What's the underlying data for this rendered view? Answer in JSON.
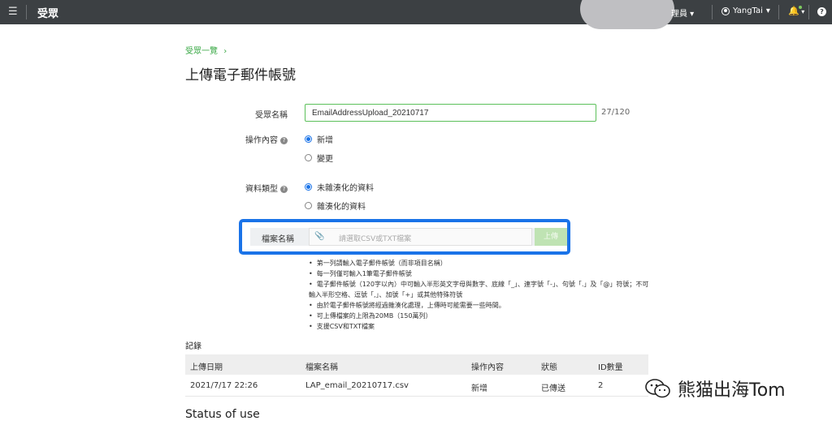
{
  "header": {
    "menu_icon": "hamburger-icon",
    "app_title": "受眾",
    "role_menu": "理員",
    "user_name": "YangTai",
    "bell_icon": "bell-icon",
    "help_icon": "help-icon"
  },
  "breadcrumb": {
    "link": "受眾一覽",
    "separator": "›"
  },
  "page_title": "上傳電子郵件帳號",
  "form": {
    "audience_name": {
      "label": "受眾名稱",
      "value": "EmailAddressUpload_20210717",
      "counter": "27/120"
    },
    "operation": {
      "label": "操作內容",
      "options": [
        {
          "label": "新增",
          "selected": true
        },
        {
          "label": "變更",
          "selected": false
        }
      ]
    },
    "data_type": {
      "label": "資料類型",
      "options": [
        {
          "label": "未雜湊化的資料",
          "selected": true
        },
        {
          "label": "雜湊化的資料",
          "selected": false
        }
      ]
    },
    "file": {
      "label": "檔案名稱",
      "placeholder": "請選取CSV或TXT檔案",
      "upload_label": "上傳"
    }
  },
  "notes": [
    "第一列請輸入電子郵件帳號（而非項目名稱）",
    "每一列僅可輸入1筆電子郵件帳號",
    "電子郵件帳號（120字以內）中可輸入半形英文字母與數字、底線「_」、連字號「-」、句號「.」及「@」符號；不可輸入半形空格、逗號「,」、加號「+」或其他特殊符號",
    "由於電子郵件帳號將經過雜湊化處理，上傳時可能需要一些時間。",
    "可上傳檔案的上限為20MB（150萬列）",
    "支援CSV和TXT檔案"
  ],
  "records": {
    "title": "記錄",
    "columns": [
      "上傳日期",
      "檔案名稱",
      "操作內容",
      "狀態",
      "ID數量"
    ],
    "rows": [
      [
        "2021/7/17 22:26",
        "LAP_email_20210717.csv",
        "新增",
        "已傳送",
        "2"
      ]
    ]
  },
  "watermark": "熊猫出海Tom",
  "status_heading": "Status of use"
}
